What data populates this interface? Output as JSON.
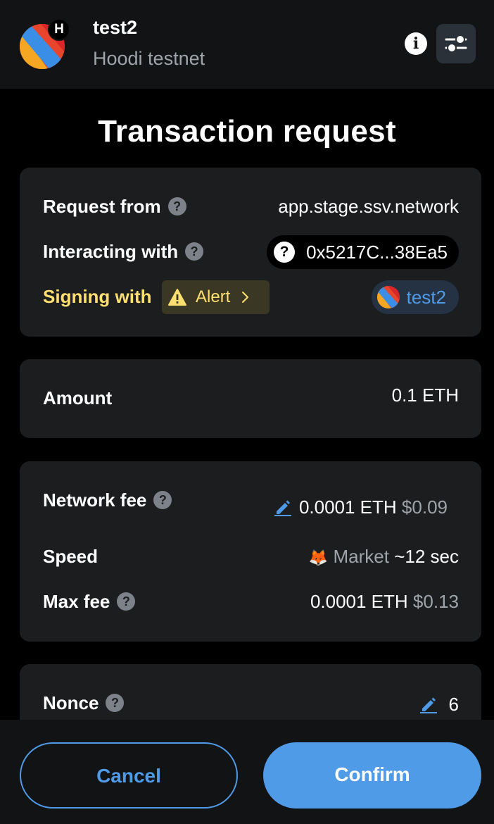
{
  "header": {
    "account_name": "test2",
    "network_name": "Hoodi testnet",
    "network_badge": "H",
    "info_icon": "info-icon",
    "settings_icon": "sliders-icon"
  },
  "title": "Transaction request",
  "request_card": {
    "request_from_label": "Request from",
    "request_from_value": "app.stage.ssv.network",
    "interacting_with_label": "Interacting with",
    "interacting_with_value": "0x5217C...38Ea5",
    "signing_with_label": "Signing with",
    "alert_label": "Alert",
    "signing_account": "test2",
    "help_glyph": "?"
  },
  "amount_card": {
    "label": "Amount",
    "value": "0.1 ETH"
  },
  "fee_card": {
    "network_fee_label": "Network fee",
    "network_fee_eth": "0.0001 ETH",
    "network_fee_fiat": "$0.09",
    "speed_label": "Speed",
    "speed_emoji": "🦊",
    "speed_mode": "Market",
    "speed_time": "~12 sec",
    "max_fee_label": "Max fee",
    "max_fee_eth": "0.0001 ETH",
    "max_fee_fiat": "$0.13"
  },
  "nonce_card": {
    "label": "Nonce",
    "value": "6"
  },
  "footer": {
    "cancel_label": "Cancel",
    "confirm_label": "Confirm"
  },
  "colors": {
    "accent": "#4f9be8",
    "warning": "#ffdf70",
    "card_bg": "#1c1d1f",
    "page_bg": "#000000"
  }
}
